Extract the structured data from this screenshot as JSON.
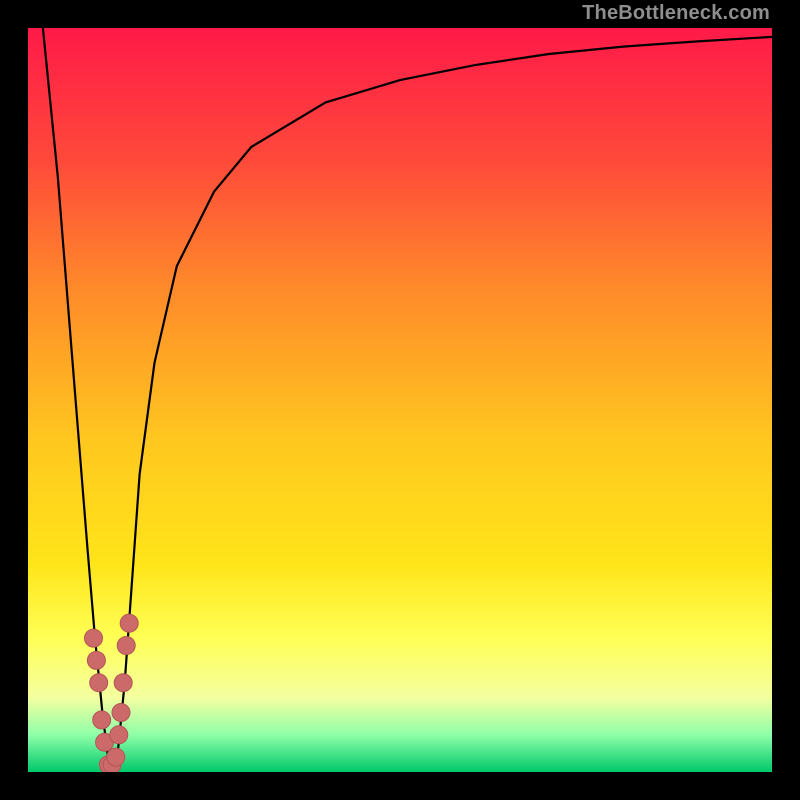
{
  "watermark": "TheBottleneck.com",
  "chart_data": {
    "type": "line",
    "title": "",
    "xlabel": "",
    "ylabel": "",
    "xlim": [
      0,
      100
    ],
    "ylim": [
      0,
      100
    ],
    "grid": false,
    "legend": false,
    "background_gradient": {
      "top": "#ff1a48",
      "mid_upper": "#ff8a2a",
      "mid": "#ffde00",
      "mid_lower": "#ffff66",
      "near_bottom": "#6aff6a",
      "bottom": "#00c86a"
    },
    "series": [
      {
        "name": "bottleneck-curve",
        "x": [
          2,
          4,
          6,
          8,
          9,
          10,
          11,
          12,
          13,
          14,
          15,
          17,
          20,
          25,
          30,
          40,
          50,
          60,
          70,
          80,
          90,
          100
        ],
        "y": [
          100,
          80,
          55,
          30,
          18,
          8,
          0,
          2,
          12,
          26,
          40,
          55,
          68,
          78,
          84,
          90,
          93,
          95,
          96.5,
          97.5,
          98.2,
          98.8
        ]
      }
    ],
    "markers": {
      "name": "highlight-cluster",
      "points": [
        {
          "x": 8.8,
          "y": 18
        },
        {
          "x": 9.2,
          "y": 15
        },
        {
          "x": 9.5,
          "y": 12
        },
        {
          "x": 9.9,
          "y": 7
        },
        {
          "x": 10.3,
          "y": 4
        },
        {
          "x": 10.8,
          "y": 1
        },
        {
          "x": 11.3,
          "y": 1
        },
        {
          "x": 11.8,
          "y": 2
        },
        {
          "x": 12.2,
          "y": 5
        },
        {
          "x": 12.5,
          "y": 8
        },
        {
          "x": 12.8,
          "y": 12
        },
        {
          "x": 13.2,
          "y": 17
        },
        {
          "x": 13.6,
          "y": 20
        }
      ],
      "radius_px": 9
    }
  }
}
